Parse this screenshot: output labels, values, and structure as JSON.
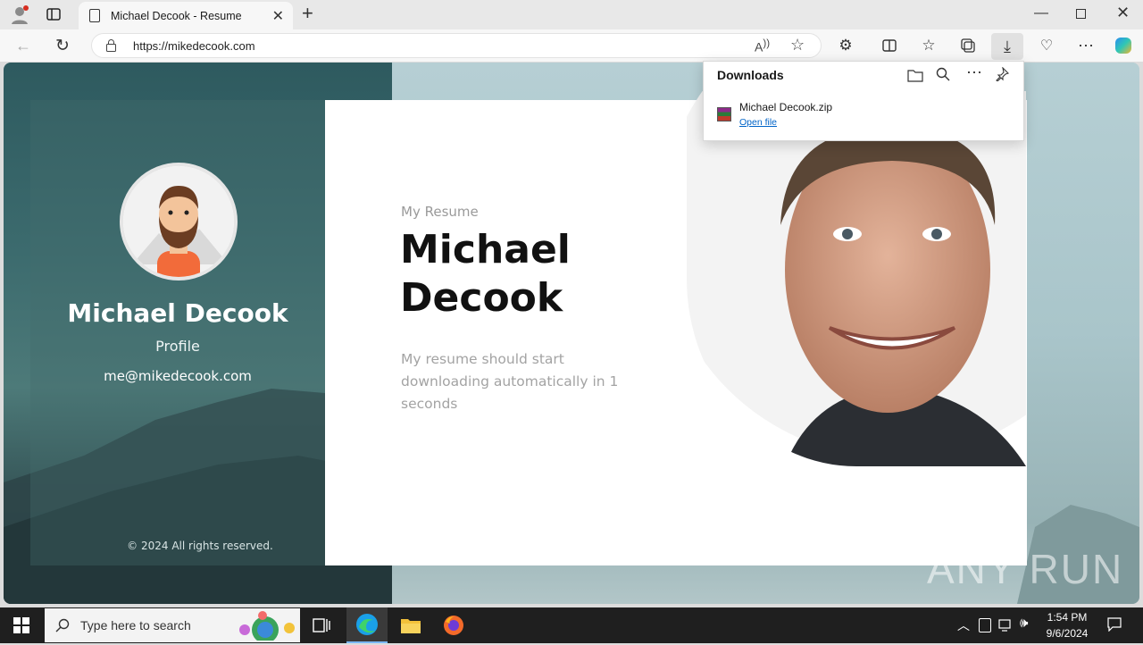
{
  "browser": {
    "tab_title": "Michael Decook - Resume",
    "url": "https://mikedecook.com"
  },
  "downloads": {
    "title": "Downloads",
    "file_name": "Michael Decook.zip",
    "open_link": "Open file"
  },
  "page": {
    "sidebar": {
      "name": "Michael Decook",
      "role": "Profile",
      "email": "me@mikedecook.com",
      "footer": "© 2024 All rights reserved."
    },
    "main": {
      "eyebrow": "My Resume",
      "heading_line1": "Michael",
      "heading_line2": "Decook",
      "message": "My resume should start downloading automatically in 1 seconds"
    }
  },
  "watermark": "ANY RUN",
  "taskbar": {
    "search_placeholder": "Type here to search",
    "time": "1:54 PM",
    "date": "9/6/2024"
  }
}
